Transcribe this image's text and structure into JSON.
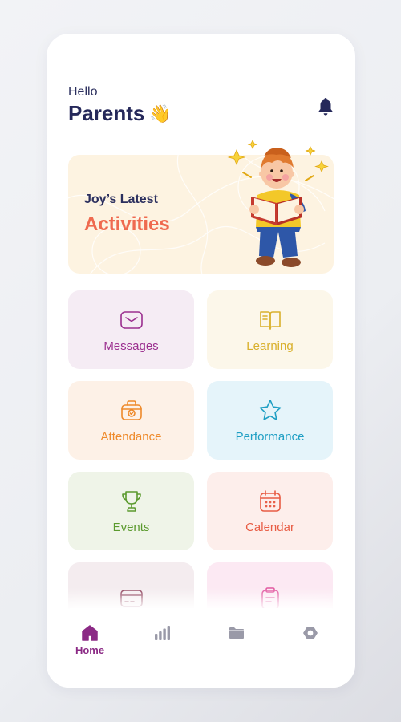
{
  "header": {
    "greeting": "Hello",
    "title": "Parents",
    "wave": "👋"
  },
  "banner": {
    "subtitle": "Joy’s Latest",
    "title": "Activities"
  },
  "tiles": [
    {
      "label": "Messages",
      "icon": "envelope-icon",
      "bg": "#f5ecf4",
      "color": "#9b2f8f"
    },
    {
      "label": "Learning",
      "icon": "book-icon",
      "bg": "#fcf7ea",
      "color": "#d9b02c"
    },
    {
      "label": "Attendance",
      "icon": "briefcase-check-icon",
      "bg": "#fdf1e7",
      "color": "#ee8a2b"
    },
    {
      "label": "Performance",
      "icon": "star-icon",
      "bg": "#e5f4fa",
      "color": "#1f9fc4"
    },
    {
      "label": "Events",
      "icon": "trophy-icon",
      "bg": "#eff4e8",
      "color": "#5b9a2e"
    },
    {
      "label": "Calendar",
      "icon": "calendar-icon",
      "bg": "#fdeeeb",
      "color": "#e85c44"
    },
    {
      "label": "",
      "icon": "card-icon",
      "bg": "#f4ecef",
      "color": "#8a3a55"
    },
    {
      "label": "",
      "icon": "clipboard-icon",
      "bg": "#fce9f3",
      "color": "#e0509c"
    }
  ],
  "tabbar": {
    "home_label": "Home",
    "active_color": "#8b2a85",
    "inactive_color": "#9a9aa8"
  }
}
